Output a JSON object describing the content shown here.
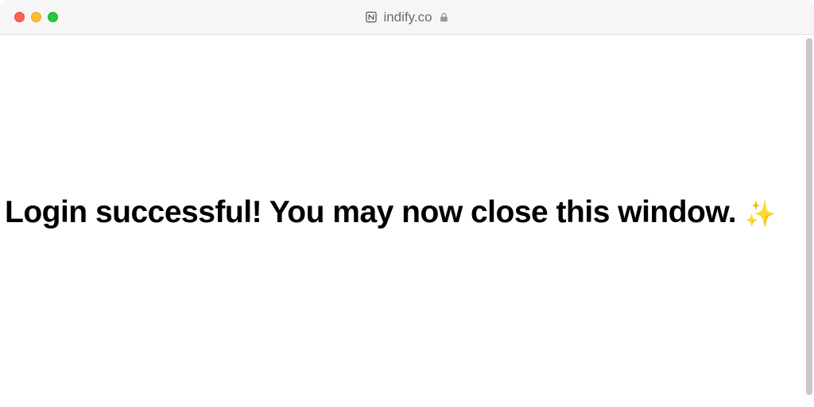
{
  "window": {
    "domain": "indify.co"
  },
  "main": {
    "message": "Login successful! You may now close this window.",
    "emoji": "✨"
  }
}
